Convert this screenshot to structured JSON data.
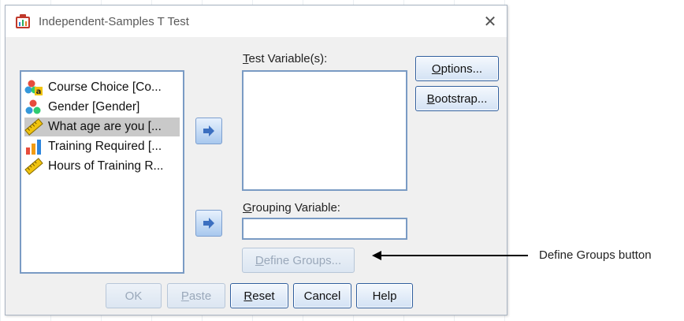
{
  "window": {
    "title": "Independent-Samples T Test",
    "close_glyph": "✕"
  },
  "variables": [
    {
      "label": "Course Choice [Co...",
      "icon": "nominal-variable-icon",
      "selected": false
    },
    {
      "label": "Gender [Gender]",
      "icon": "nominal-variable-icon",
      "selected": false
    },
    {
      "label": "What age are you [...",
      "icon": "scale-variable-icon",
      "selected": true
    },
    {
      "label": "Training Required [...",
      "icon": "ordinal-variable-icon",
      "selected": false
    },
    {
      "label": "Hours of Training R...",
      "icon": "scale-variable-icon",
      "selected": false
    }
  ],
  "test_variables": {
    "label_mnemonic": "T",
    "label_rest": "est Variable(s):"
  },
  "grouping_variable": {
    "label_mnemonic": "G",
    "label_rest": "rouping Variable:",
    "value": ""
  },
  "buttons": {
    "options": {
      "mnemonic": "O",
      "rest": "ptions..."
    },
    "bootstrap": {
      "mnemonic": "B",
      "rest": "ootstrap..."
    },
    "define_groups": {
      "mnemonic": "D",
      "rest": "efine Groups...",
      "enabled": false
    },
    "ok": {
      "label": "OK",
      "enabled": false
    },
    "paste": {
      "mnemonic": "P",
      "rest": "aste",
      "enabled": false
    },
    "reset": {
      "mnemonic": "R",
      "rest": "eset"
    },
    "cancel": {
      "label": "Cancel"
    },
    "help": {
      "label": "Help"
    }
  },
  "annotation": {
    "text": "Define Groups button"
  },
  "colors": {
    "accent": "#2f5e9e",
    "field_border": "#7a9bc4",
    "arrow": "#3b6fc0"
  }
}
